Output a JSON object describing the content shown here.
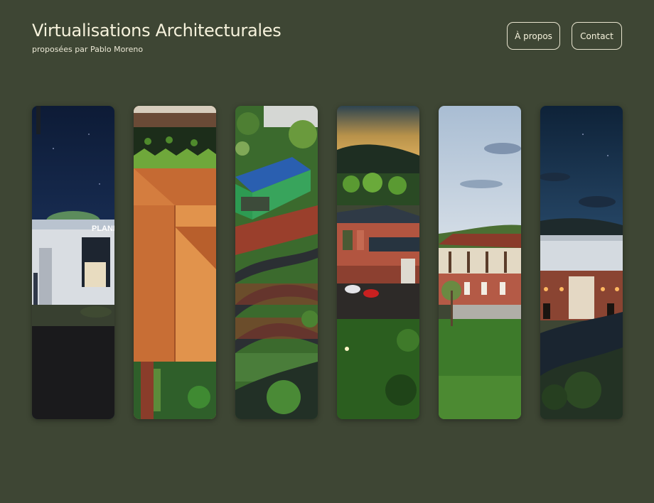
{
  "header": {
    "title": "Virtualisations Architecturales",
    "subtitle": "proposées par Pablo Moreno"
  },
  "nav": {
    "about_label": "À propos",
    "contact_label": "Contact"
  },
  "gallery": {
    "panels": [
      {
        "name": "gallery-panel-planetarium-night",
        "sign_text": "PLANI"
      },
      {
        "name": "gallery-panel-tiled-roof"
      },
      {
        "name": "gallery-panel-blue-roof-road"
      },
      {
        "name": "gallery-panel-red-building-dusk"
      },
      {
        "name": "gallery-panel-timbered-house-day"
      },
      {
        "name": "gallery-panel-lit-building-night"
      }
    ]
  },
  "colors": {
    "background": "#3e4634",
    "text": "#f6f2dc",
    "button_border": "#e8e4cf"
  }
}
